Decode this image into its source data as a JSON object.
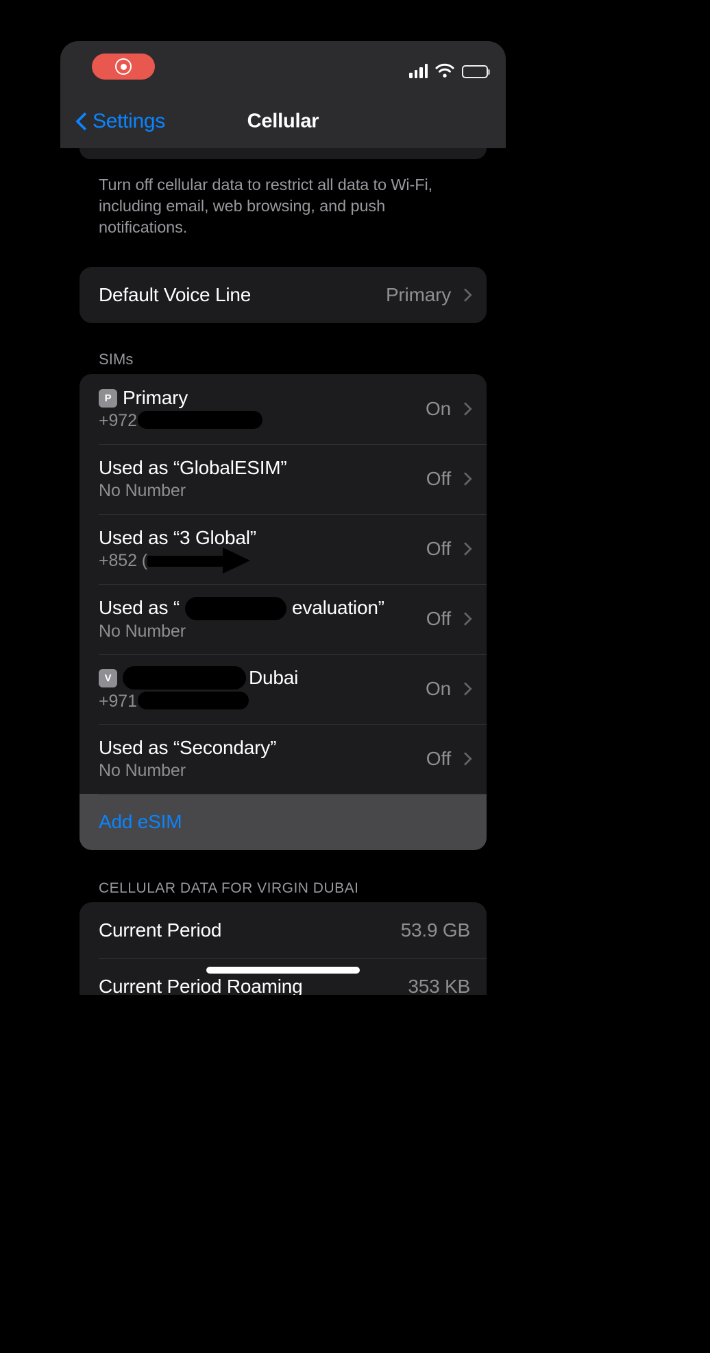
{
  "status_bar": {
    "recording_indicator": "record-pill",
    "signal_icon": "cellular-signal-icon",
    "wifi_icon": "wifi-icon",
    "battery_icon": "battery-icon"
  },
  "nav": {
    "back_label": "Settings",
    "title": "Cellular"
  },
  "footer_note": "Turn off cellular data to restrict all data to Wi-Fi, including email, web browsing, and push notifications.",
  "default_voice_line": {
    "label": "Default Voice Line",
    "value": "Primary"
  },
  "sims_section": {
    "header": "SIMs",
    "rows": [
      {
        "badge": "P",
        "title": "Primary",
        "subtitle_prefix": "+972",
        "redacted": true,
        "status": "On"
      },
      {
        "badge": "",
        "title": "Used as “GlobalESIM”",
        "subtitle_prefix": "No Number",
        "redacted": false,
        "status": "Off"
      },
      {
        "badge": "",
        "title": "Used as “3 Global”",
        "subtitle_prefix": "+852 (",
        "redacted": true,
        "status": "Off"
      },
      {
        "badge": "",
        "title_prefix": "Used as “",
        "title_suffix": "evaluation”",
        "subtitle_prefix": "No Number",
        "redacted": true,
        "status": "Off"
      },
      {
        "badge": "V",
        "title_suffix": "Dubai",
        "subtitle_prefix": "+971",
        "redacted": true,
        "status": "On"
      },
      {
        "badge": "",
        "title": "Used as “Secondary”",
        "subtitle_prefix": "No Number",
        "redacted": false,
        "status": "Off"
      }
    ],
    "add_esim_label": "Add eSIM"
  },
  "cellular_data_section": {
    "header": "CELLULAR DATA FOR VIRGIN DUBAI",
    "rows": [
      {
        "label": "Current Period",
        "value": "53.9 GB"
      },
      {
        "label": "Current Period Roaming",
        "value": "353 KB"
      }
    ]
  },
  "colors": {
    "accent_blue": "#0a84ff",
    "record_red": "#e8584f",
    "group_bg": "#1c1c1e",
    "nav_bg": "#2c2c2e",
    "secondary_text": "#8e8e93",
    "highlight_bg": "#48484a"
  }
}
